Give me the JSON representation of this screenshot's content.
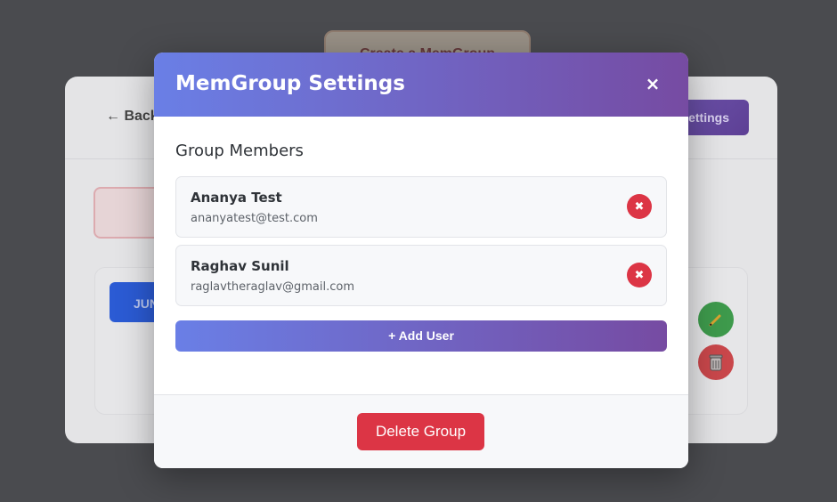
{
  "background": {
    "create_button_label": "Create a MemGroup",
    "back_label": "← Back",
    "settings_button_label": "Settings",
    "month_badge": "JUN"
  },
  "modal": {
    "title": "MemGroup Settings",
    "close_icon": "×",
    "section_title": "Group Members",
    "members": [
      {
        "name": "Ananya Test",
        "email": "ananyatest@test.com"
      },
      {
        "name": "Raghav Sunil",
        "email": "raglavtheraglav@gmail.com"
      }
    ],
    "remove_icon": "✖",
    "add_user_label": "+ Add User",
    "delete_group_label": "Delete Group"
  },
  "colors": {
    "header_gradient_start": "#6a7fe6",
    "header_gradient_end": "#764ba2",
    "danger": "#dc3545",
    "overlay": "#4a4b4f"
  }
}
